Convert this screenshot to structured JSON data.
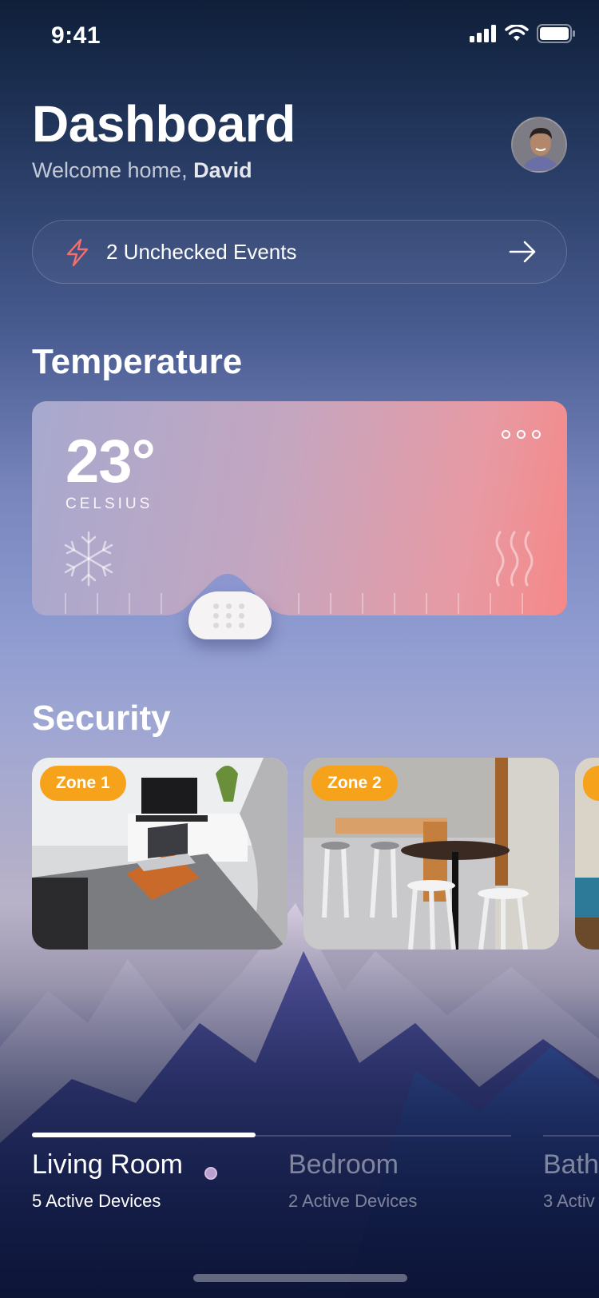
{
  "status_bar": {
    "time": "9:41"
  },
  "header": {
    "title": "Dashboard",
    "welcome_prefix": "Welcome home,",
    "user_name": "David"
  },
  "events": {
    "label": "2 Unchecked Events",
    "icon": "lightning-icon",
    "arrow": "arrow-right-icon"
  },
  "temperature": {
    "heading": "Temperature",
    "value": "23°",
    "unit": "CELSIUS",
    "icons": [
      "snowflake-icon",
      "heat-waves-icon",
      "more-icon"
    ]
  },
  "security": {
    "heading": "Security",
    "zones": [
      {
        "label": "Zone 1"
      },
      {
        "label": "Zone 2"
      }
    ]
  },
  "rooms": [
    {
      "name": "Living Room",
      "devices": "5 Active Devices",
      "active": true
    },
    {
      "name": "Bedroom",
      "devices": "2 Active Devices",
      "active": false
    },
    {
      "name": "Bath",
      "devices": "3 Activ",
      "active": false
    }
  ],
  "colors": {
    "accent_orange": "#f7a21b",
    "event_icon": "#f36f6f",
    "card_start": "#a7a9cf",
    "card_end": "#f58887"
  }
}
